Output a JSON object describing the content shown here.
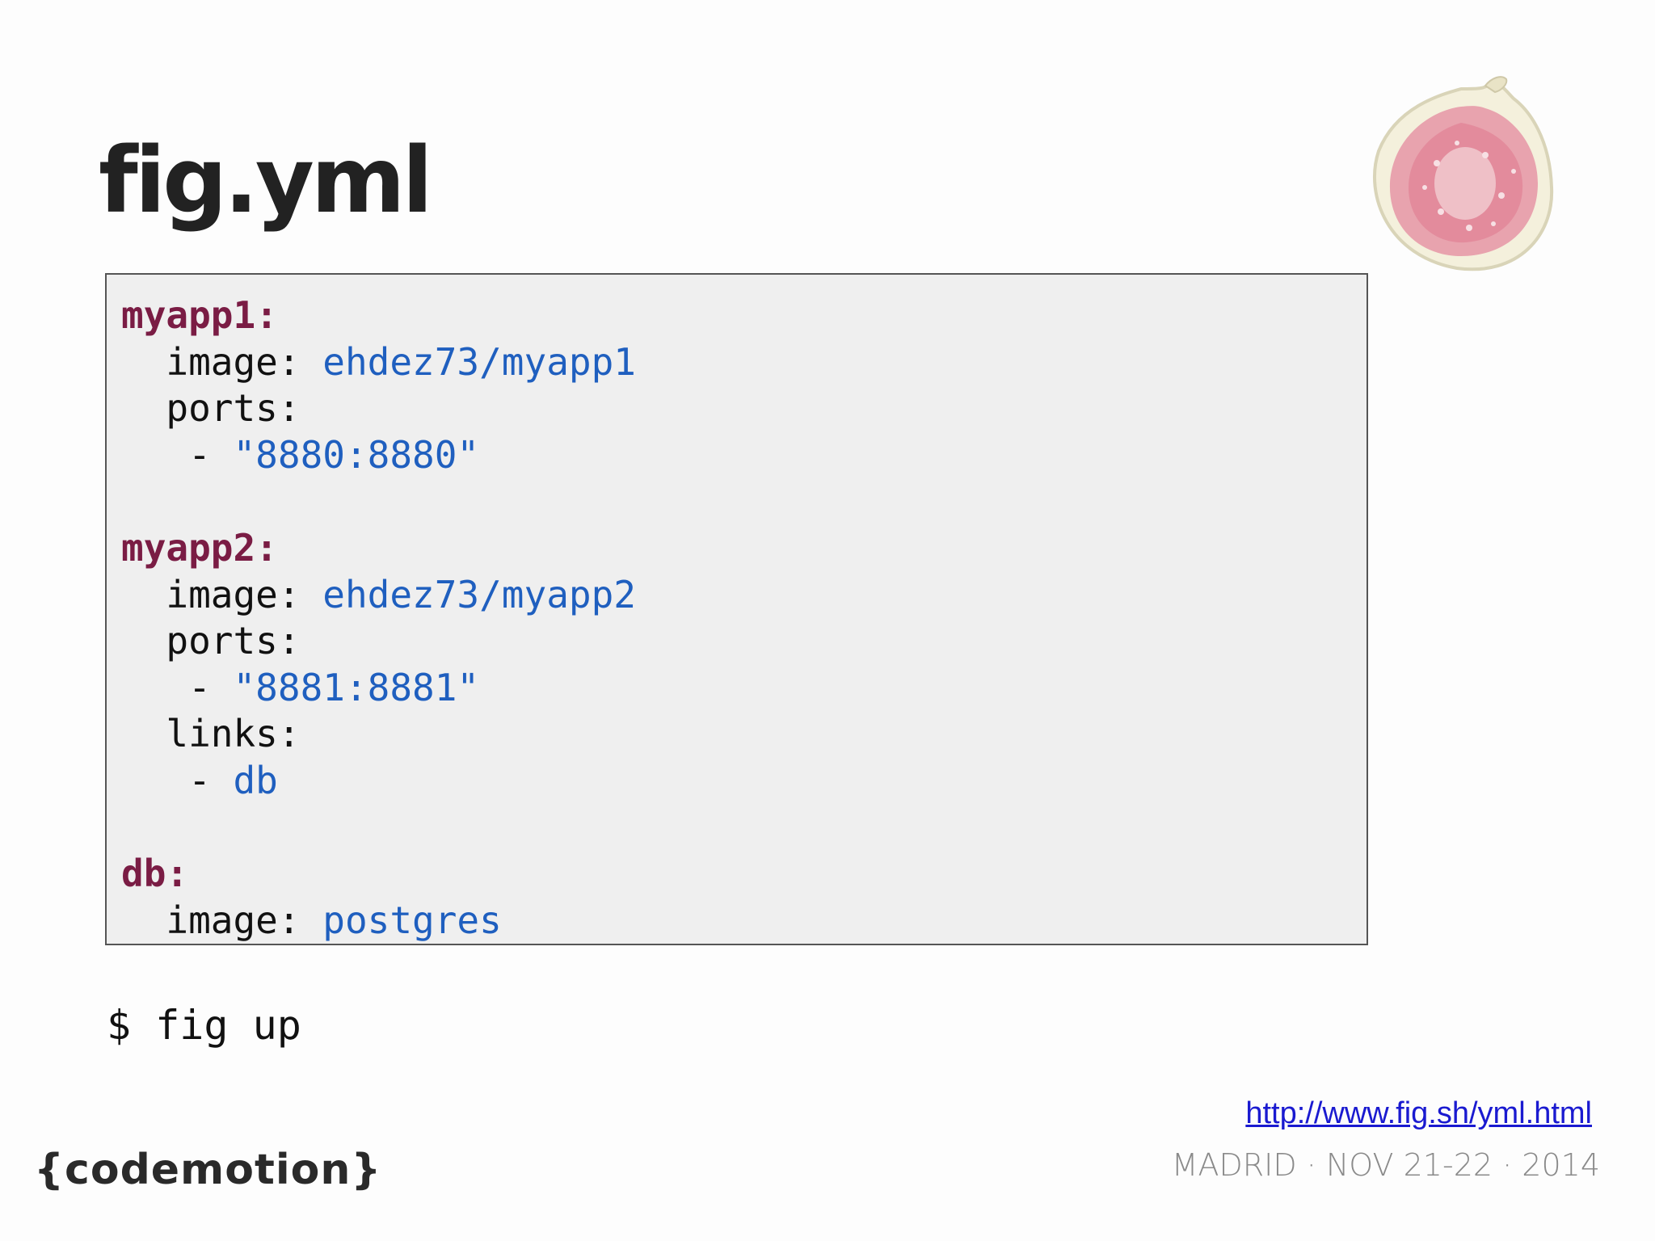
{
  "slide": {
    "title": "fig.yml",
    "code_lines": [
      {
        "key": "myapp1:",
        "text": "",
        "value": "",
        "top": true
      },
      {
        "key": "",
        "text": "  image: ",
        "value": "ehdez73/myapp1",
        "top": false
      },
      {
        "key": "",
        "text": "  ports:",
        "value": "",
        "top": false
      },
      {
        "key": "",
        "text": "   - ",
        "value": "\"8880:8880\"",
        "top": false
      },
      {
        "key": "",
        "text": "",
        "value": "",
        "top": false
      },
      {
        "key": "myapp2:",
        "text": "",
        "value": "",
        "top": true
      },
      {
        "key": "",
        "text": "  image: ",
        "value": "ehdez73/myapp2",
        "top": false
      },
      {
        "key": "",
        "text": "  ports:",
        "value": "",
        "top": false
      },
      {
        "key": "",
        "text": "   - ",
        "value": "\"8881:8881\"",
        "top": false
      },
      {
        "key": "",
        "text": "  links:",
        "value": "",
        "top": false
      },
      {
        "key": "",
        "text": "   - ",
        "value": "db",
        "top": false
      },
      {
        "key": "",
        "text": "",
        "value": "",
        "top": false
      },
      {
        "key": "db:",
        "text": "",
        "value": "",
        "top": true
      },
      {
        "key": "",
        "text": "  image: ",
        "value": "postgres",
        "top": false
      }
    ],
    "command": "$ fig up",
    "link": "http://www.fig.sh/yml.html",
    "event_info": "MADRID · NOV 21-22 · 2014",
    "logo_text": "{codemotion}"
  },
  "colors": {
    "top_key": "#7a1c44",
    "value": "#1f5fbf",
    "code_background": "#efefef",
    "link": "#1a1ad0"
  },
  "icons": [
    "fig-fruit-icon",
    "codemotion-logo"
  ]
}
